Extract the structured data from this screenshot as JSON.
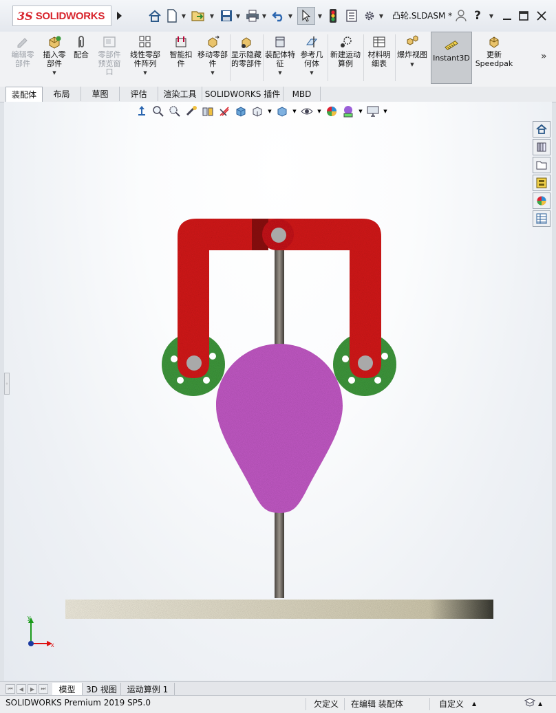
{
  "app": {
    "logo_ds": "3S",
    "logo_text": "SOLIDWORKS",
    "doc_name": "凸轮.SLDASM *",
    "help_glyph": "?"
  },
  "ribbon": {
    "items": [
      {
        "label": "编辑零部件",
        "icon": "edit-component-icon",
        "disabled": true
      },
      {
        "label": "插入零部件",
        "icon": "insert-components-icon",
        "disabled": false
      },
      {
        "label": "配合",
        "icon": "mate-icon",
        "disabled": false
      },
      {
        "label": "零部件预览窗口",
        "icon": "component-preview-icon",
        "disabled": true
      },
      {
        "label": "线性零部件阵列",
        "icon": "linear-pattern-icon",
        "disabled": false
      },
      {
        "label": "智能扣件",
        "icon": "smart-fasteners-icon",
        "disabled": false
      },
      {
        "label": "移动零部件",
        "icon": "move-component-icon",
        "disabled": false
      },
      {
        "label": "显示隐藏的零部件",
        "icon": "show-hidden-icon",
        "disabled": false
      },
      {
        "label": "装配体特征",
        "icon": "assembly-features-icon",
        "disabled": false
      },
      {
        "label": "参考几何体",
        "icon": "reference-geometry-icon",
        "disabled": false
      },
      {
        "label": "新建运动算例",
        "icon": "new-motion-study-icon",
        "disabled": false
      },
      {
        "label": "材料明细表",
        "icon": "bill-of-materials-icon",
        "disabled": false
      },
      {
        "label": "爆炸视图",
        "icon": "exploded-view-icon",
        "disabled": false
      },
      {
        "label": "Instant3D",
        "icon": "instant3d-icon",
        "disabled": false
      },
      {
        "label": "更新Speedpak",
        "icon": "update-speedpak-icon",
        "disabled": false
      }
    ]
  },
  "tabs": [
    "装配体",
    "布局",
    "草图",
    "评估",
    "渲染工具",
    "SOLIDWORKS 插件",
    "MBD"
  ],
  "active_tab": "装配体",
  "triad": {
    "x": "x",
    "y": "y"
  },
  "bottom_tabs": [
    "模型",
    "3D 视图",
    "运动算例 1"
  ],
  "status": {
    "product": "SOLIDWORKS Premium 2019 SP5.0",
    "definition": "欠定义",
    "editing": "在编辑 装配体",
    "units": "自定义"
  },
  "colors": {
    "linkage": "#d9151b",
    "cam": "#c25bc2",
    "disc": "#3a9a3a",
    "base": "#d7d0b4"
  }
}
